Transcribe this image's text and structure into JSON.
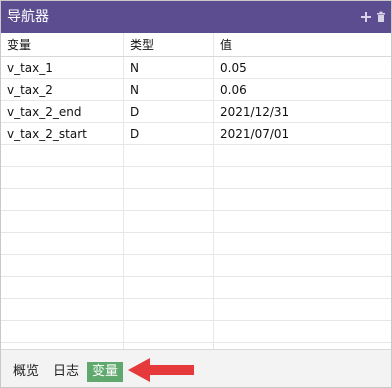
{
  "header": {
    "title": "导航器",
    "icons": [
      "add-icon",
      "trash-icon"
    ]
  },
  "table": {
    "columns": [
      "变量",
      "类型",
      "值"
    ],
    "rows": [
      {
        "name": "v_tax_1",
        "type": "N",
        "value": "0.05"
      },
      {
        "name": "v_tax_2",
        "type": "N",
        "value": "0.06"
      },
      {
        "name": "v_tax_2_end",
        "type": "D",
        "value": "2021/12/31"
      },
      {
        "name": "v_tax_2_start",
        "type": "D",
        "value": "2021/07/01"
      }
    ]
  },
  "footer": {
    "tabs": [
      {
        "label": "概览"
      },
      {
        "label": "日志"
      },
      {
        "label": "变量",
        "active": true
      }
    ]
  },
  "colors": {
    "header_bg": "#5b4d8f",
    "active_tab_bg": "#5fa96e",
    "arrow": "#e5393b"
  }
}
